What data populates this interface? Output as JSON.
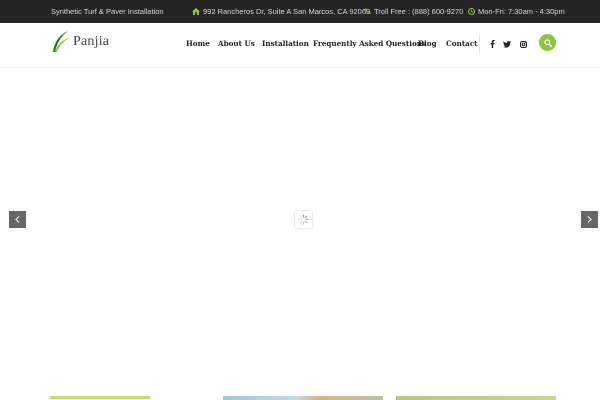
{
  "topbar": {
    "tagline": "Synthetic Turf & Paver Installation",
    "address": "992 Rancheros Dr, Suite A San Marcos, CA 92069",
    "phone": "Troll Free : (888) 600-9270",
    "hours": "Mon-Fri: 7:30am - 4:30pm"
  },
  "logo": {
    "text": "Panjia"
  },
  "nav": {
    "items": [
      "Home",
      "About Us",
      "Installation",
      "Frequently Asked Questions",
      "Blog",
      "Contact"
    ]
  },
  "social": {
    "icons": [
      "facebook-icon",
      "twitter-icon",
      "instagram-icon"
    ]
  },
  "search": {
    "icon": "search-icon"
  },
  "colors": {
    "accent": "#8cc63f",
    "topbar": "#252525",
    "arrow": "#666666"
  }
}
